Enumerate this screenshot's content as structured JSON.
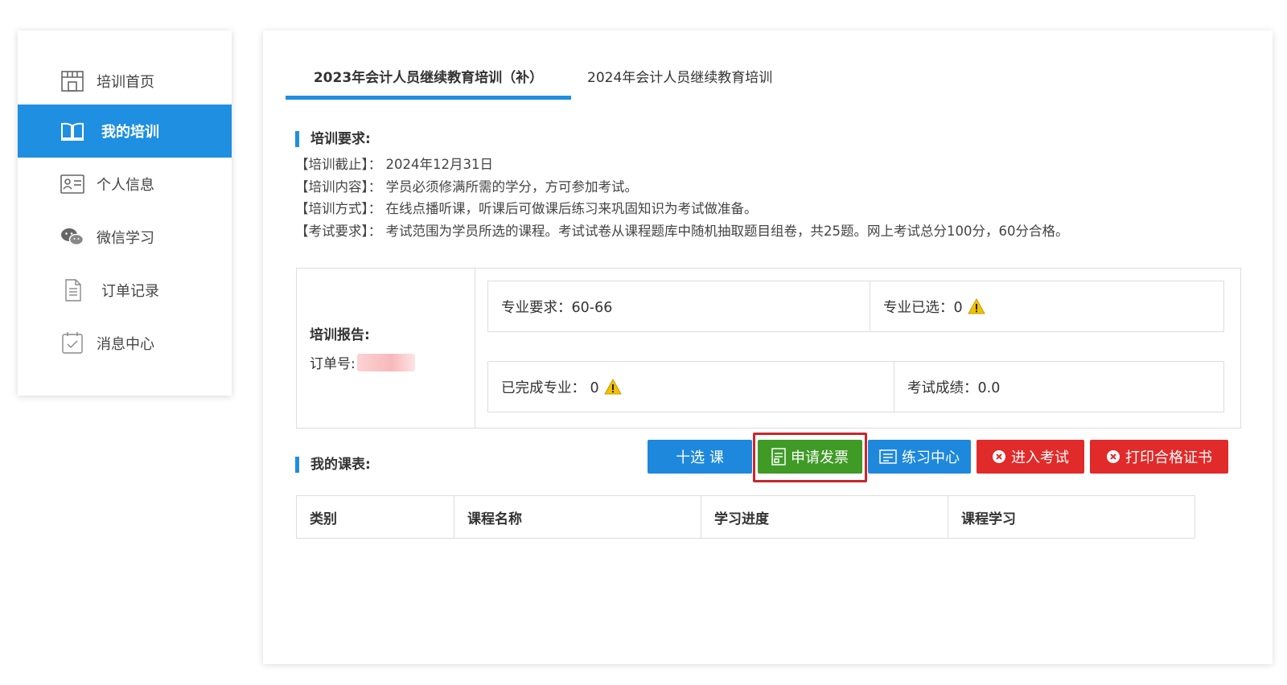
{
  "sidebar": {
    "items": [
      {
        "label": "培训首页",
        "icon": "storefront-icon",
        "active": false
      },
      {
        "label": "我的培训",
        "icon": "open-book-icon",
        "active": true
      },
      {
        "label": "个人信息",
        "icon": "id-card-icon",
        "active": false
      },
      {
        "label": "微信学习",
        "icon": "wechat-icon",
        "active": false
      },
      {
        "label": "订单记录",
        "icon": "document-icon",
        "active": false
      },
      {
        "label": "消息中心",
        "icon": "calendar-check-icon",
        "active": false
      }
    ]
  },
  "tabs": [
    {
      "label": "2023年会计人员继续教育培训（补）",
      "active": true
    },
    {
      "label": "2024年会计人员继续教育培训",
      "active": false
    }
  ],
  "requirements": {
    "title": "培训要求:",
    "lines": [
      "【培训截止】：  2024年12月31日",
      "【培训内容】：  学员必须修满所需的学分，方可参加考试。",
      "【培训方式】：  在线点播听课，听课后可做课后练习来巩固知识为考试做准备。",
      "【考试要求】：  考试范围为学员所选的课程。考试试卷从课程题库中随机抽取题目组卷，共25题。网上考试总分100分，60分合格。"
    ]
  },
  "report": {
    "title": "培训报告:",
    "order_label": "订单号:",
    "major_required": "专业要求：60-66",
    "major_selected": "专业已选：0",
    "major_completed": "已完成专业：  0",
    "exam_score": "考试成绩：0.0"
  },
  "schedule": {
    "title": "我的课表:",
    "buttons": {
      "select": "十选  课",
      "invoice": "申请发票",
      "practice": "练习中心",
      "exam": "进入考试",
      "print": "打印合格证书"
    },
    "columns": [
      "类别",
      "课程名称",
      "学习进度",
      "课程学习"
    ]
  },
  "colors": {
    "accent": "#1e8fe1",
    "green": "#3f9a26",
    "red": "#e12a2a",
    "highlight": "#c8262c",
    "warning": "#f2c200"
  }
}
